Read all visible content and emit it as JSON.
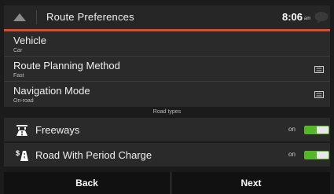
{
  "header": {
    "title": "Route Preferences",
    "time": "8:06",
    "ampm": "am"
  },
  "rows": [
    {
      "label": "Vehicle",
      "value": "Car"
    },
    {
      "label": "Route Planning Method",
      "value": "Fast"
    },
    {
      "label": "Navigation Mode",
      "value": "On-road"
    }
  ],
  "section": {
    "road_types_label": "Road types"
  },
  "toggles": [
    {
      "label": "Freeways",
      "state_text": "on",
      "icon": "freeway-icon"
    },
    {
      "label": "Road With Period Charge",
      "state_text": "on",
      "icon": "toll-road-icon"
    }
  ],
  "buttons": {
    "back": "Back",
    "next": "Next"
  },
  "colors": {
    "accent": "#e14a26",
    "toggle_on": "#55b62a",
    "row_bg": "#2a2a2a",
    "background": "#1b1b1b"
  }
}
